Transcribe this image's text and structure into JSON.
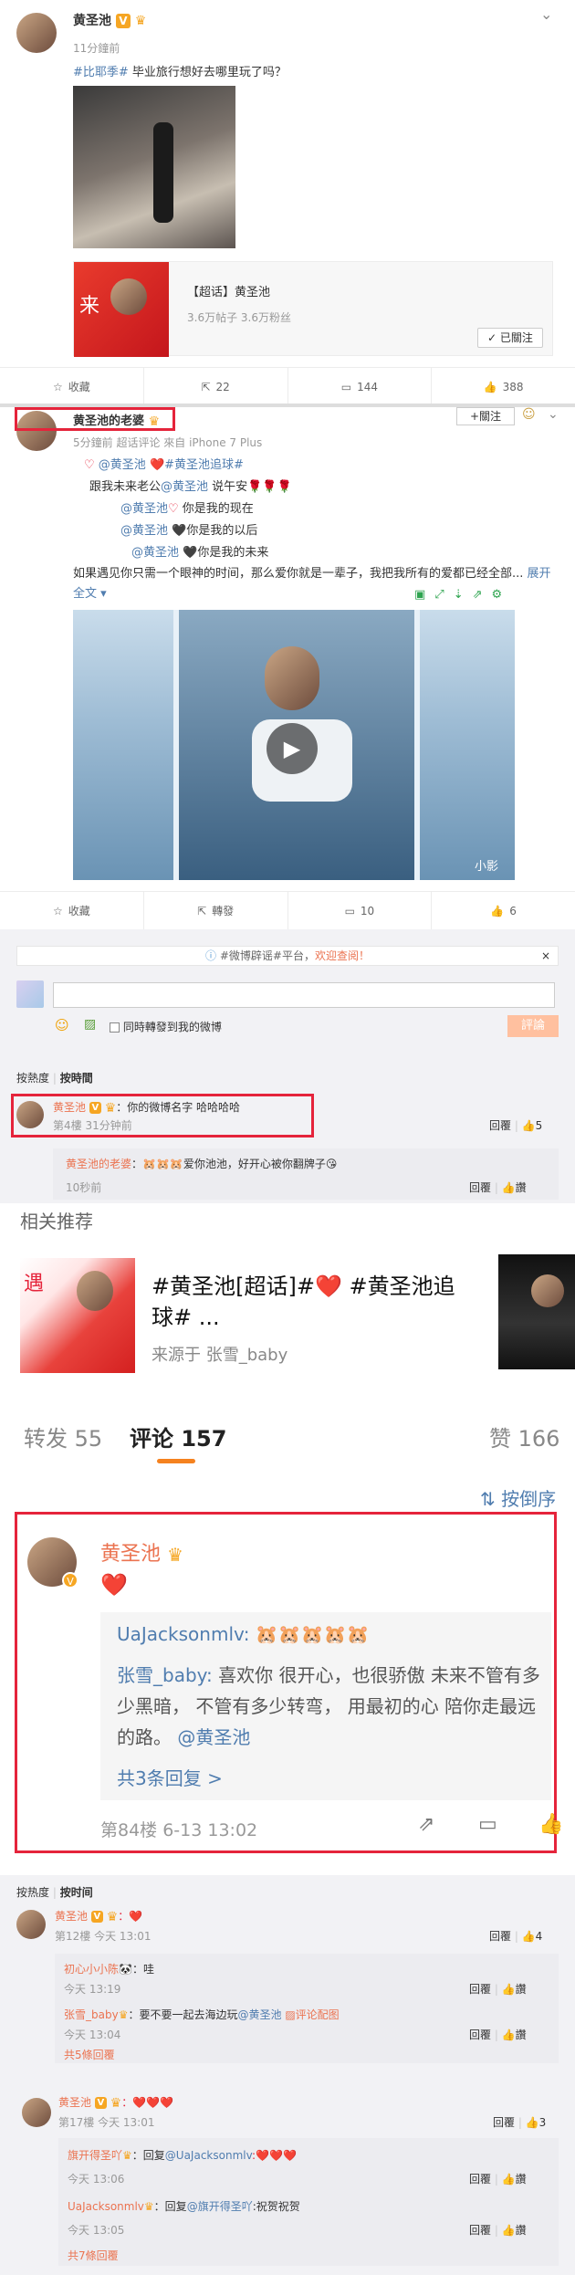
{
  "post1": {
    "author": "黄圣池",
    "time": "11分鐘前",
    "topic": "#比耶季#",
    "text": " 毕业旅行想好去哪里玩了吗？",
    "card": {
      "title": "【超话】黄圣池",
      "stats": "3.6万帖子 3.6万粉丝",
      "follow_label": "已關注"
    },
    "actions": {
      "fav": "收藏",
      "repost": "22",
      "comment": "144",
      "like": "388"
    }
  },
  "post2": {
    "author": "黄圣池的老婆",
    "meta": "5分鐘前 超话评论 來自 iPhone 7 Plus",
    "follow_label": "+關注",
    "line1_mention": "@黄圣池",
    "line1_topic": "#黄圣池追球#",
    "line2": "跟我未来老公",
    "line2_mention": "@黄圣池",
    "line2_tail": " 说午安🌹🌹🌹",
    "line3_mention": "@黄圣池",
    "line3_tail": " 你是我的现在",
    "line4_mention": "@黄圣池",
    "line4_tail": " 🖤你是我的以后",
    "line5_mention": "@黄圣池",
    "line5_tail": " 🖤你是我的未来",
    "para": "如果遇见你只需一个眼神的时间，那么爱你就是一辈子，我把我所有的爱都已经全部...",
    "expand": "展开全文 ▾",
    "video_watermark": "小影",
    "actions": {
      "fav": "收藏",
      "repost": "轉發",
      "comment": "10",
      "like": "6"
    }
  },
  "comment_box": {
    "notice_prefix": "#微博辟谣#平台，",
    "notice_link": "欢迎查阅！",
    "also_repost": "同時轉發到我的微博",
    "submit": "評論"
  },
  "sort1": {
    "hot": "按熱度",
    "time": "按時間"
  },
  "c1": {
    "name": "黄圣池",
    "text": "：你的微博名字 哈哈哈哈",
    "meta": "第4樓 31分钟前",
    "reply": "回覆",
    "likes": "5",
    "sub_name": "黄圣池的老婆",
    "sub_text": "：🐹🐹🐹爱你池池，好开心被你翻牌子😘",
    "sub_time": "10秒前",
    "sub_reply": "回覆",
    "sub_like": "讚"
  },
  "related": {
    "header": "相关推荐",
    "title": "#黄圣池[超话]#❤️ #黄圣池追球# ...",
    "source": "来源于 张雪_baby"
  },
  "tabs": {
    "repost": "转发 55",
    "comment": "评论 157",
    "like": "赞 166"
  },
  "order": "⇅ 按倒序",
  "mobile_comment": {
    "name": "黄圣池",
    "heart": "❤️",
    "quote_name": "UaJacksonmlv:",
    "quote_emoji": "🐹🐹🐹🐹🐹",
    "quote2_name": "张雪_baby:",
    "quote2_text": " 喜欢你 很开心，也很骄傲 未来不管有多少黑暗，  不管有多少转弯， 用最初的心 陪你走最远的路。",
    "quote2_mention": "@黄圣池",
    "replies": "共3条回复 >",
    "meta": "第84楼  6-13 13:02"
  },
  "sort2": {
    "hot": "按热度",
    "time": "按时间"
  },
  "c2": {
    "name": "黄圣池",
    "text": "：❤️",
    "meta": "第12樓 今天 13:01",
    "reply": "回覆",
    "likes": "4",
    "subs": [
      {
        "name": "初心小小陈",
        "text": "：哇",
        "time": "今天 13:19"
      },
      {
        "name": "张雪_baby",
        "text": "：要不要一起去海边玩",
        "mention": "@黄圣池",
        "pic": "评论配图",
        "time": "今天 13:04"
      }
    ],
    "more": "共5條回覆"
  },
  "c3": {
    "name": "黄圣池",
    "text": "：❤️❤️❤️",
    "meta": "第17樓 今天 13:01",
    "reply": "回覆",
    "likes": "3",
    "subs": [
      {
        "name": "旗开得圣吖",
        "text": "：回复",
        "mention": "@UaJacksonmlv",
        "tail": ":❤️❤️❤️",
        "time": "今天 13:06"
      },
      {
        "name": "UaJacksonmlv",
        "text": "：回复",
        "mention": "@旗开得圣吖",
        "tail": ":祝贺祝贺",
        "time": "今天 13:05"
      }
    ],
    "more": "共7條回覆"
  },
  "sub_reply": "回覆",
  "sub_like": "讚"
}
